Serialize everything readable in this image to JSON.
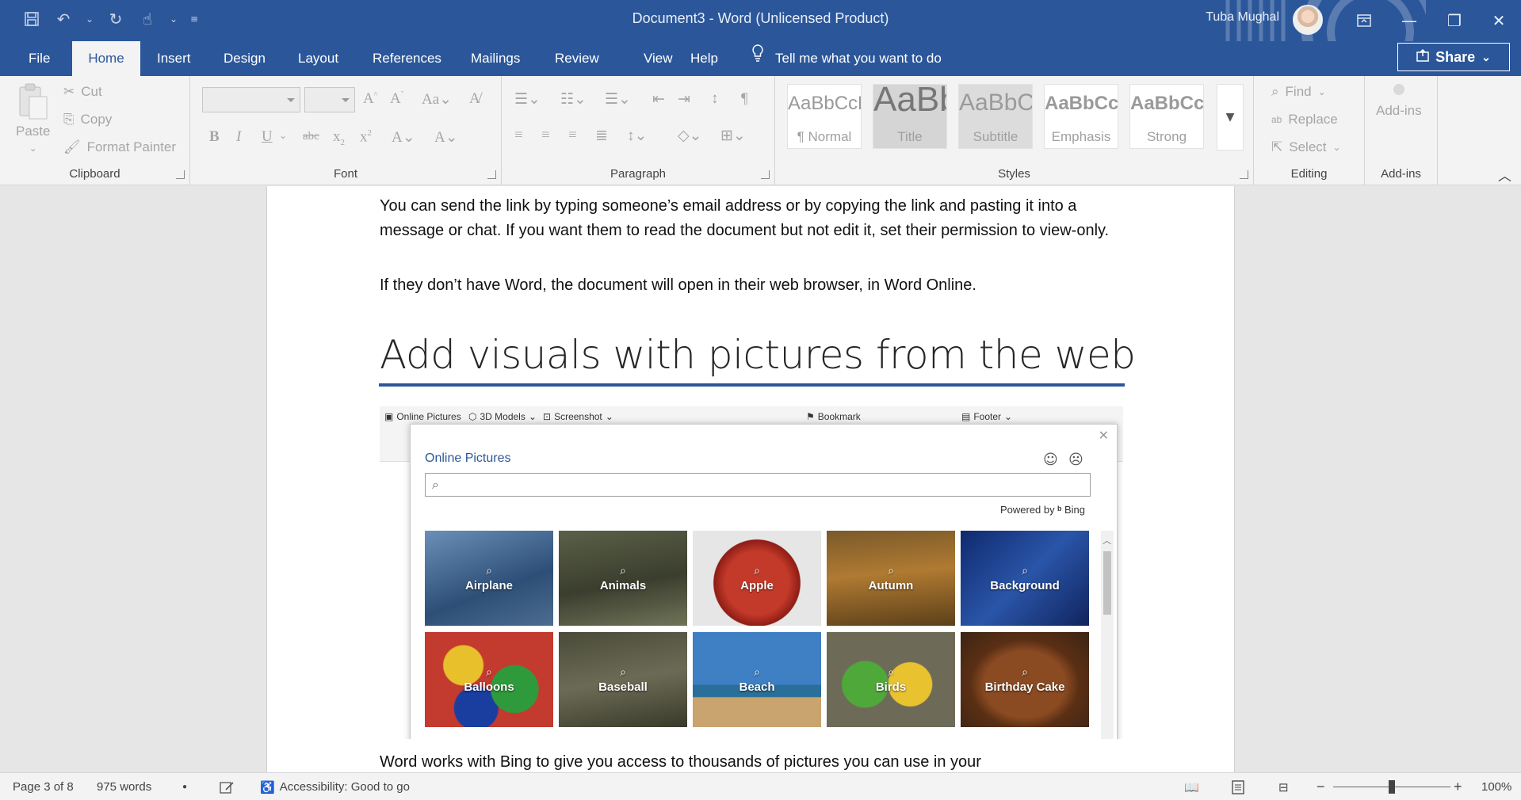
{
  "window": {
    "title": "Document3  -  Word (Unlicensed Product)",
    "user_name": "Tuba Mughal",
    "colors": {
      "brand": "#2b579a",
      "ribbon_bg": "#f3f3f3",
      "workspace_bg": "#e6e6e6"
    }
  },
  "quick_access": {
    "save_icon": "save-icon",
    "undo_icon": "undo-icon",
    "redo_icon": "redo-icon",
    "touch_icon": "touch-mode-icon"
  },
  "tabs": [
    "File",
    "Home",
    "Insert",
    "Design",
    "Layout",
    "References",
    "Mailings",
    "Review",
    "View",
    "Help"
  ],
  "active_tab": "Home",
  "tell_me": "Tell me what you want to do",
  "share_label": "Share",
  "ribbon": {
    "clipboard": {
      "label": "Clipboard",
      "paste": "Paste",
      "cut": "Cut",
      "copy": "Copy",
      "format_painter": "Format Painter"
    },
    "font": {
      "label": "Font"
    },
    "paragraph": {
      "label": "Paragraph"
    },
    "styles": {
      "label": "Styles",
      "items": [
        {
          "sample": "AaBbCcDd",
          "name": "¶ Normal"
        },
        {
          "sample": "AaBbC",
          "name": "Title"
        },
        {
          "sample": "AaBbCc",
          "name": "Subtitle"
        },
        {
          "sample": "AaBbCcD",
          "name": "Emphasis"
        },
        {
          "sample": "AaBbCcD",
          "name": "Strong"
        }
      ]
    },
    "editing": {
      "label": "Editing",
      "find": "Find",
      "replace": "Replace",
      "select": "Select"
    },
    "addins": {
      "label": "Add-ins",
      "button": "Add-ins"
    }
  },
  "document": {
    "para1": "You can send the link by typing someone’s email address or by copying the link and pasting it into a message or chat. If you want them to read the document but not edit it, set their permission to view-only.",
    "para2": "If they don’t have Word, the document will open in their web browser, in Word Online.",
    "heading": "Add visuals with pictures from the web",
    "para3": "Word works with Bing to give you access to thousands of pictures you can use in your",
    "embedded_image": {
      "toolbar": [
        "Online Pictures",
        "3D Models",
        "Screenshot",
        "Bookmark",
        "Footer"
      ],
      "dialog_title": "Online Pictures",
      "powered_by": "Powered by",
      "bing": "Bing",
      "categories": [
        "Airplane",
        "Animals",
        "Apple",
        "Autumn",
        "Background",
        "Balloons",
        "Baseball",
        "Beach",
        "Birds",
        "Birthday Cake"
      ]
    }
  },
  "status": {
    "page": "Page 3 of 8",
    "words": "975 words",
    "accessibility": "Accessibility: Good to go",
    "zoom": "100%",
    "zoom_percent": 100
  }
}
